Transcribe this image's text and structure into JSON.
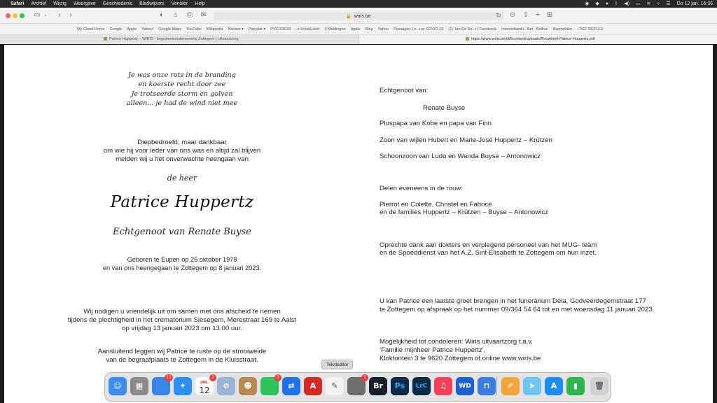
{
  "menubar": {
    "app_name": "Safari",
    "items": [
      "Archief",
      "Wijzig",
      "Weergave",
      "Geschiedenis",
      "Bladwijzers",
      "Venster",
      "Help"
    ],
    "clock": "Do 12 jan.  16:36"
  },
  "toolbar": {
    "address": "wiris.be"
  },
  "favorites": [
    "My Cloud Home",
    "Google",
    "Apple",
    "Yahoo!",
    "Google Maps",
    "YouTube",
    "Wikipedia",
    "Nieuws ▾",
    "Populair ▾",
    "PVZ163033 - ...s UniekLoket",
    "0 Meldingen",
    "Apple",
    "Bing",
    "Yahoo",
    "Passagier Lo...rus COVID-19",
    "(1) Jan De Sn...t | Facebook",
    "Internetbanki...Net - Belfius",
    "Aanmelden - ...TIEF REFLEX"
  ],
  "tabs": [
    {
      "label": "Patrice Huppertz – WIRIS - begrafenisonderneming Zottegem | Uitvaartzorg"
    },
    {
      "label": "https://www.wiris.be/b86content/uploads/Rouwbrief-Patrice-Huppertz.pdf"
    }
  ],
  "document": {
    "poem": [
      "Je was onze rots in de branding",
      "en koerste recht door zee",
      "Je trotseerde storm en golven",
      "alleen... je had de wind niet mee"
    ],
    "intro": [
      "Diepbedroefd, maar dankbaar",
      "om wie hij voor ieder van ons was en altijd zal blijven",
      "melden wij u het onverwachte heengaan van"
    ],
    "salutation": "de heer",
    "deceased_name": "Patrice Huppertz",
    "spouse_subtitle": "Echtgenoot van Renate Buyse",
    "dates": [
      "Geboren te Eupen op 25 oktober 1978",
      "en van ons heengegaan te Zottegem op 8 januari 2023."
    ],
    "invite": [
      "Wij nodigen u vriendelijk uit om samen met ons afscheid te nemen",
      "tijdens de plechtigheid in het crematorium Siesegem, Merestraat 169 te Aalst",
      "op vrijdag 13 januari 2023 om 13.00 uur."
    ],
    "burial": [
      "Aansluitend leggen wij Patrice te ruste op de strooiweide",
      "van de begraafplaats te Zottegem in de Kluisstraat."
    ],
    "right": {
      "spouse_heading": "Echtgenoot van:",
      "spouse_name": "Renate Buyse",
      "plus_papa": "Pluspapa van Kobe en papa van Finn",
      "son_of": "Zoon van wijlen Hubert en Marie-José Huppertz – Krützen",
      "son_in_law": "Schoonzoon van Ludo en Wanda Buyse – Antonowicz",
      "mourning_heading": "Delen eveneens in de rouw:",
      "mourning_1": "Pierrot en Colette, Christel en Fabrice",
      "mourning_2": "en de families Huppertz – Krützen – Buyse – Antonowicz",
      "thanks_1": "Oprechte dank aan dokters en verplegend personeel van het MUG- team",
      "thanks_2": "en de Spoeddienst van het A.Z. Sint-Elisabeth te Zottegem om hun inzet.",
      "funerarium_1": "U kan Patrice een laatste groet brengen in het funerarium Dela, Godveerdegemstraat 177",
      "funerarium_2": "te Zottegem op afspraak op het nummer 09/364 54 64 tot en met woensdag 11 januari 2023.",
      "condolence_1": "Mogelijkheid tot condoleren: Wiris uitvaartzorg t.a.v.",
      "condolence_2": "‘Familie mijnheer Patrice Huppertz’,",
      "condolence_3": "Klokfontein 3 te 9620 Zottegem of online www.wiris.be"
    }
  },
  "tooltip": "Teksteditor",
  "dock": {
    "calendar_month": "JAN.",
    "calendar_day": "12",
    "badges": {
      "mail": "11",
      "calendar": "2",
      "facetime": "3",
      "settings": "1"
    },
    "apps": [
      {
        "name": "Finder",
        "color": "#3d8ef0",
        "glyph": "☺"
      },
      {
        "name": "Launchpad",
        "color": "#8a8a8a",
        "glyph": "▦"
      },
      {
        "name": "Mail",
        "color": "#3a86e8",
        "glyph": "✉"
      },
      {
        "name": "Safari",
        "color": "#2d8ff2",
        "glyph": "✦"
      },
      {
        "name": "Calendar",
        "color": "#ffffff",
        "glyph": ""
      },
      {
        "name": "Blocked",
        "color": "#9ab4d8",
        "glyph": "⊘"
      },
      {
        "name": "Contacts",
        "color": "#b78a52",
        "glyph": "☻"
      },
      {
        "name": "FaceTime",
        "color": "#30c25a",
        "glyph": "▶"
      },
      {
        "name": "TeamViewer",
        "color": "#1e73e6",
        "glyph": "⇄"
      },
      {
        "name": "Acrobat",
        "color": "#d42a22",
        "glyph": "A"
      },
      {
        "name": "TextEdit",
        "color": "#f2f2f2",
        "glyph": "✎"
      },
      {
        "name": "System Settings",
        "color": "#6e6e6e",
        "glyph": "⚙"
      },
      {
        "name": "Bridge",
        "color": "#1a1f2e",
        "glyph": "Br"
      },
      {
        "name": "Photoshop",
        "color": "#0b2a4a",
        "glyph": "Ps"
      },
      {
        "name": "Lightroom Classic",
        "color": "#0b2a4a",
        "glyph": "LrC"
      },
      {
        "name": "Music",
        "color": "#f2415a",
        "glyph": "♫"
      },
      {
        "name": "WD Discovery",
        "color": "#1b5fd1",
        "glyph": "WD"
      },
      {
        "name": "Keynote",
        "color": "#3a7fe0",
        "glyph": "⊓"
      },
      {
        "name": "Pages",
        "color": "#f2a33a",
        "glyph": "✐"
      },
      {
        "name": "Maps",
        "color": "#6fc7f0",
        "glyph": "➤"
      },
      {
        "name": "App Store",
        "color": "#1c8ef3",
        "glyph": "A"
      },
      {
        "name": "Numbers",
        "color": "#2eb54e",
        "glyph": "▮"
      },
      {
        "name": "Trash",
        "color": "#d0d0d0",
        "glyph": "🗑"
      }
    ]
  }
}
